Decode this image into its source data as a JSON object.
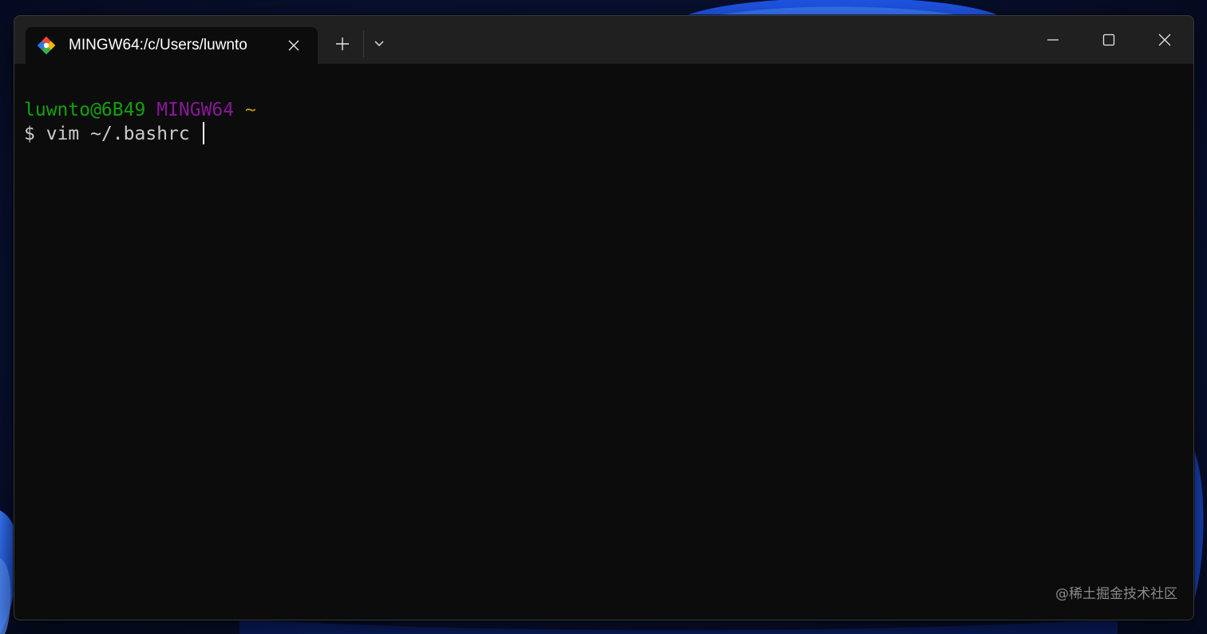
{
  "tab": {
    "title": "MINGW64:/c/Users/luwnto",
    "icon": "git-bash-icon"
  },
  "titlebar": {
    "new_tab_icon": "plus-icon",
    "dropdown_icon": "chevron-down-icon",
    "minimize_icon": "minimize-icon",
    "maximize_icon": "maximize-icon",
    "close_icon": "close-icon"
  },
  "terminal": {
    "prompt_user_host": "luwnto@6B49",
    "prompt_system": "MINGW64",
    "prompt_path": "~",
    "prompt_symbol": "$",
    "command": "vim ~/.bashrc"
  },
  "watermark": "@稀土掘金技术社区",
  "colors": {
    "user_host": "#13a10e",
    "system": "#881798",
    "path": "#c19c00",
    "command_text": "#cccccc",
    "terminal_bg": "#0c0c0c",
    "titlebar_bg": "#202020"
  }
}
